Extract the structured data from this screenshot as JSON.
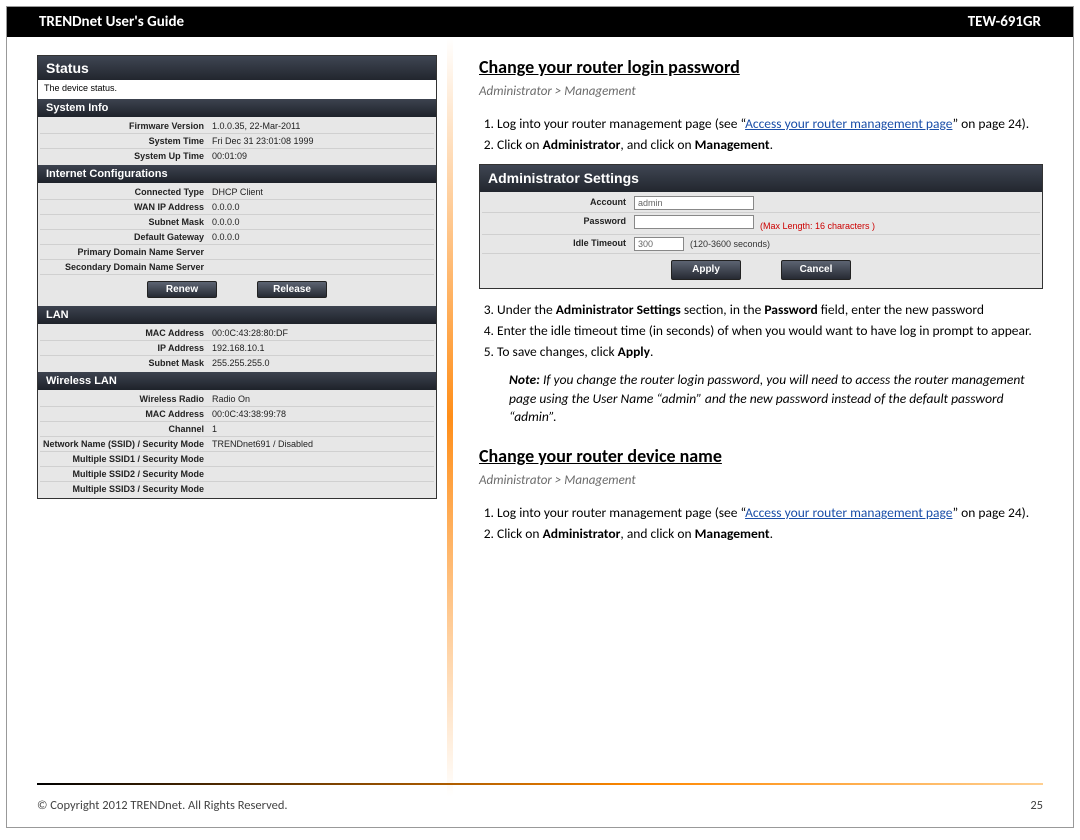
{
  "header": {
    "left": "TRENDnet User's Guide",
    "right": "TEW-691GR"
  },
  "status_panel": {
    "title": "Status",
    "subtitle": "The device status.",
    "sections": [
      {
        "head": "System Info",
        "rows": [
          {
            "k": "Firmware Version",
            "v": "1.0.0.35, 22-Mar-2011"
          },
          {
            "k": "System Time",
            "v": "Fri Dec 31 23:01:08 1999"
          },
          {
            "k": "System Up Time",
            "v": "00:01:09"
          }
        ]
      },
      {
        "head": "Internet Configurations",
        "rows": [
          {
            "k": "Connected Type",
            "v": "DHCP Client"
          },
          {
            "k": "WAN IP Address",
            "v": "0.0.0.0"
          },
          {
            "k": "Subnet Mask",
            "v": "0.0.0.0"
          },
          {
            "k": "Default Gateway",
            "v": "0.0.0.0"
          },
          {
            "k": "Primary Domain Name Server",
            "v": ""
          },
          {
            "k": "Secondary Domain Name Server",
            "v": ""
          }
        ],
        "buttons": [
          "Renew",
          "Release"
        ]
      },
      {
        "head": "LAN",
        "rows": [
          {
            "k": "MAC Address",
            "v": "00:0C:43:28:80:DF"
          },
          {
            "k": "IP Address",
            "v": "192.168.10.1"
          },
          {
            "k": "Subnet Mask",
            "v": "255.255.255.0"
          }
        ]
      },
      {
        "head": "Wireless LAN",
        "rows": [
          {
            "k": "Wireless Radio",
            "v": "Radio On"
          },
          {
            "k": "MAC Address",
            "v": "00:0C:43:38:99:78"
          },
          {
            "k": "Channel",
            "v": "1"
          },
          {
            "k": "Network Name (SSID) / Security Mode",
            "v": "TRENDnet691 / Disabled"
          },
          {
            "k": "Multiple SSID1 / Security Mode",
            "v": ""
          },
          {
            "k": "Multiple SSID2 / Security Mode",
            "v": ""
          },
          {
            "k": "Multiple SSID3 / Security Mode",
            "v": ""
          }
        ]
      }
    ]
  },
  "right": {
    "section1": {
      "heading": "Change your router login password",
      "breadcrumb": "Administrator > Management",
      "step1_a": "Log into your router management page (see “",
      "step1_link": "Access your router management page",
      "step1_b": "” on page 24).",
      "step2_a": "Click on ",
      "step2_b": "Administrator",
      "step2_c": ", and click on ",
      "step2_d": "Management",
      "step2_e": ".",
      "step3_a": "Under the ",
      "step3_b": "Administrator Settings",
      "step3_c": " section, in the ",
      "step3_d": "Password",
      "step3_e": " field, enter the new password",
      "step4": "Enter the idle timeout time (in seconds) of when you would want to have log in prompt to appear.",
      "step5_a": "To save changes, click ",
      "step5_b": "Apply",
      "step5_c": ".",
      "note_a": "Note:",
      "note_b": " If you change the router login password, you will need to access the router management page using the User Name “admin” and the new password instead of the default password “admin”."
    },
    "admin_panel": {
      "title": "Administrator Settings",
      "account_lbl": "Account",
      "account_val": "admin",
      "password_lbl": "Password",
      "password_hint": "(Max Length: 16 characters )",
      "idle_lbl": "Idle Timeout",
      "idle_val": "300",
      "idle_hint": "(120-3600 seconds)",
      "apply": "Apply",
      "cancel": "Cancel"
    },
    "section2": {
      "heading": "Change your router device name",
      "breadcrumb": "Administrator > Management",
      "step1_a": "Log into your router management page (see “",
      "step1_link": "Access your router management page",
      "step1_b": "” on page 24).",
      "step2_a": "Click on ",
      "step2_b": "Administrator",
      "step2_c": ", and click on ",
      "step2_d": "Management",
      "step2_e": "."
    }
  },
  "footer": {
    "copyright": "© Copyright 2012 TRENDnet. All Rights Reserved.",
    "page": "25"
  }
}
